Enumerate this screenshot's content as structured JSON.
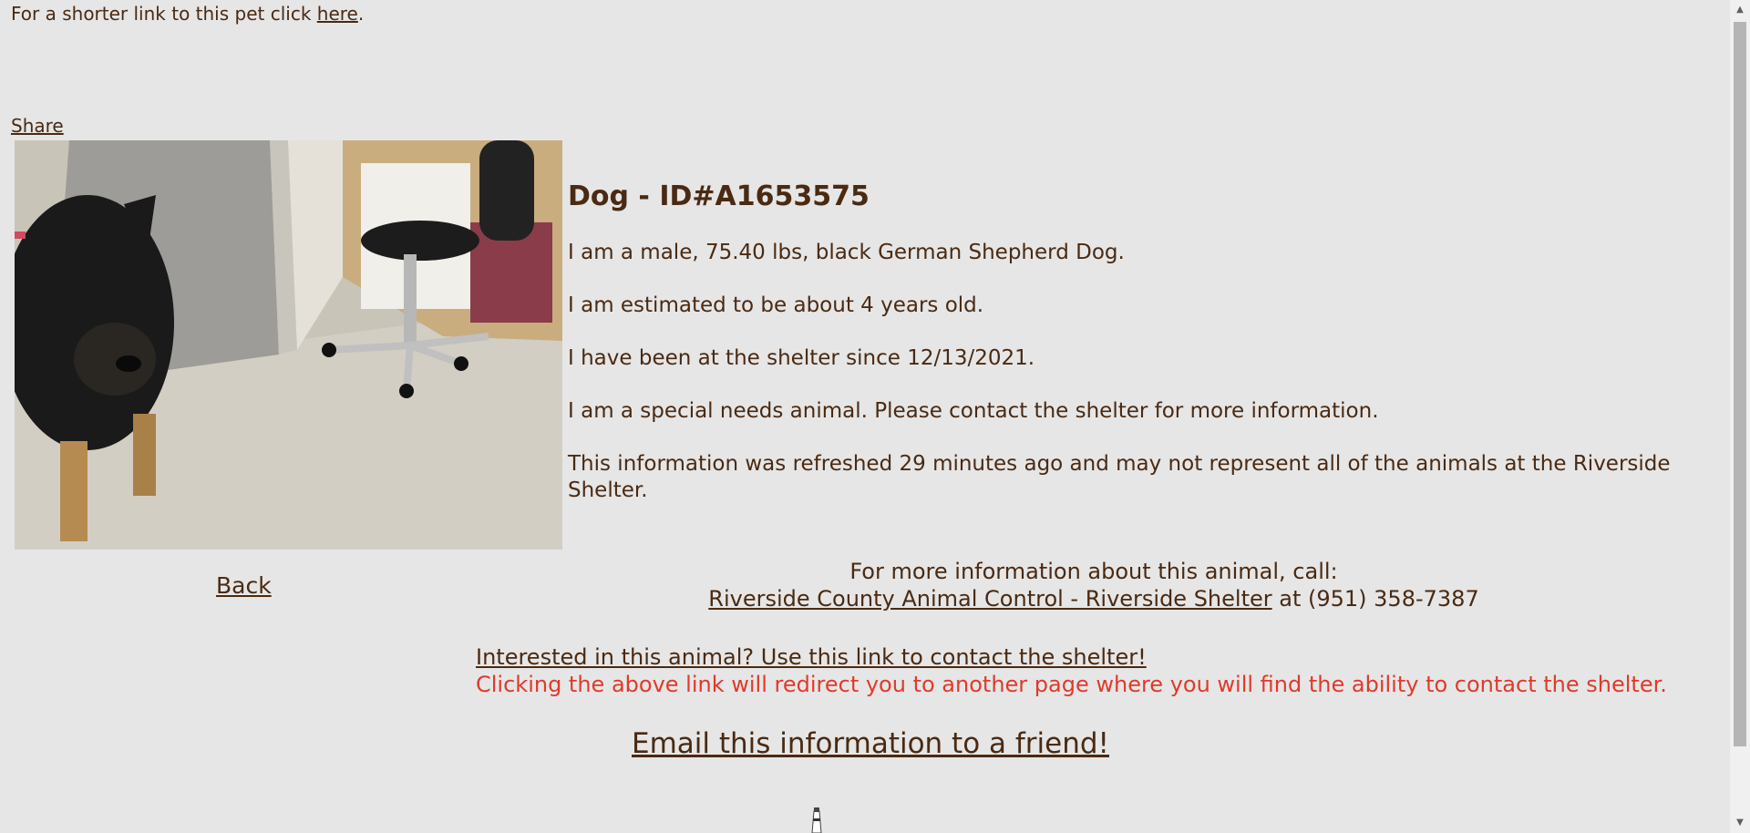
{
  "header": {
    "shortlink_prefix": "For a shorter link to this pet click ",
    "shortlink_link": "here",
    "shortlink_suffix": ".",
    "share_label": "Share"
  },
  "animal": {
    "title": "Dog - ID#A1653575",
    "description": "I am a male, 75.40 lbs, black German Shepherd Dog.",
    "age": "I am estimated to be about 4 years old.",
    "shelter_since": "I have been at the shelter since 12/13/2021.",
    "special_needs": "I am a special needs animal. Please contact the shelter for more information.",
    "refreshed_note": "This information was refreshed 29 minutes ago and may not represent all of the animals at the Riverside Shelter."
  },
  "nav": {
    "back_label": "Back"
  },
  "contact": {
    "call_prompt": "For more information about this animal, call:",
    "shelter_link": "Riverside County Animal Control - Riverside Shelter",
    "phone_text": " at (951) 358-7387",
    "interest_link": "Interested in this animal? Use this link to contact the shelter!",
    "redirect_warning": "Clicking the above link will redirect you to another page where you will find the ability to contact the shelter.",
    "email_link": "Email this information to a friend!"
  },
  "icons": {
    "scroll_up": "scroll-up-arrow-icon",
    "scroll_down": "scroll-down-arrow-icon",
    "footer": "lighthouse-icon"
  },
  "colors": {
    "background": "#e6e6e6",
    "text": "#4a2a12",
    "warning": "#e03a2a"
  }
}
